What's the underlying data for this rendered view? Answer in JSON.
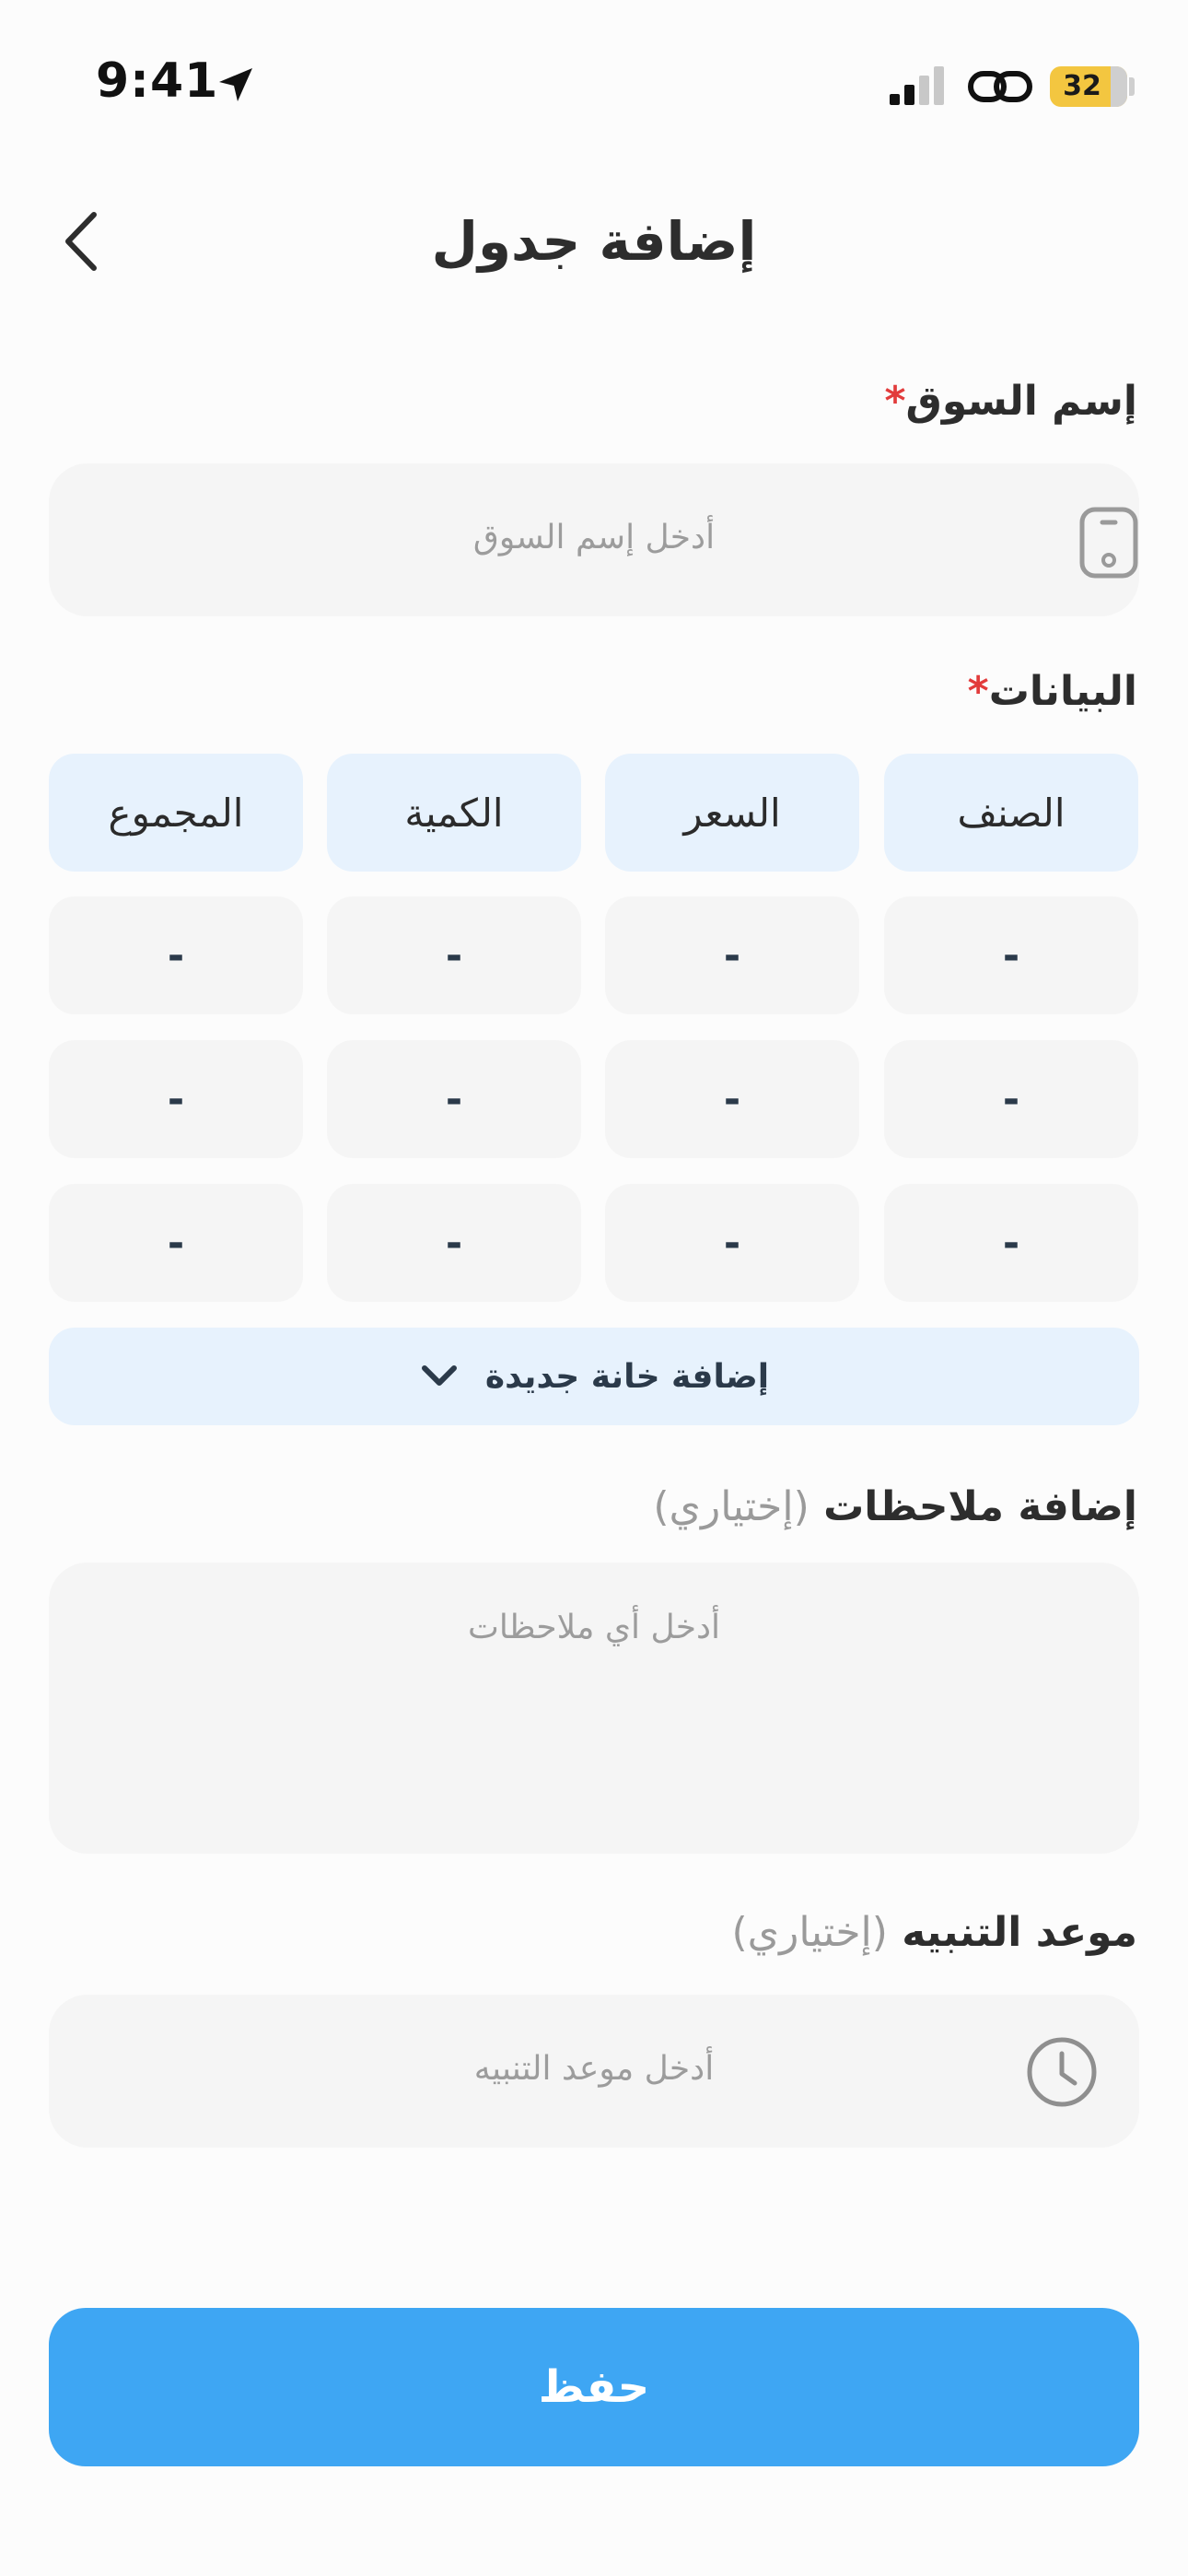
{
  "status_bar": {
    "time": "9:41",
    "battery": "32",
    "location_icon": "location-arrow-icon",
    "signal_icon": "cellular-signal-icon",
    "link_icon": "link-icon",
    "battery_color": "#f3c640"
  },
  "header": {
    "title": "إضافة جدول",
    "back_icon": "chevron-left-icon"
  },
  "market": {
    "label": "إسم السوق",
    "required_mark": "*",
    "placeholder": "أدخل إسم السوق",
    "icon": "phone-icon"
  },
  "data_table": {
    "label": "البيانات",
    "required_mark": "*",
    "columns": [
      "الصنف",
      "السعر",
      "الكمية",
      "المجموع"
    ],
    "rows": [
      [
        "-",
        "-",
        "-",
        "-"
      ],
      [
        "-",
        "-",
        "-",
        "-"
      ],
      [
        "-",
        "-",
        "-",
        "-"
      ]
    ],
    "add_row_label": "إضافة خانة جديدة",
    "add_row_icon": "chevron-down-icon"
  },
  "notes": {
    "label": "إضافة ملاحظات",
    "optional": "(إختياري)",
    "placeholder": "أدخل أي ملاحظات"
  },
  "reminder": {
    "label": "موعد التنبيه",
    "optional": "(إختياري)",
    "placeholder": "أدخل موعد التنبيه",
    "icon": "clock-icon"
  },
  "save_label": "حفظ",
  "colors": {
    "accent": "#3ea6f3",
    "header_cell": "#e7f2fd",
    "required": "#e23b3b"
  }
}
